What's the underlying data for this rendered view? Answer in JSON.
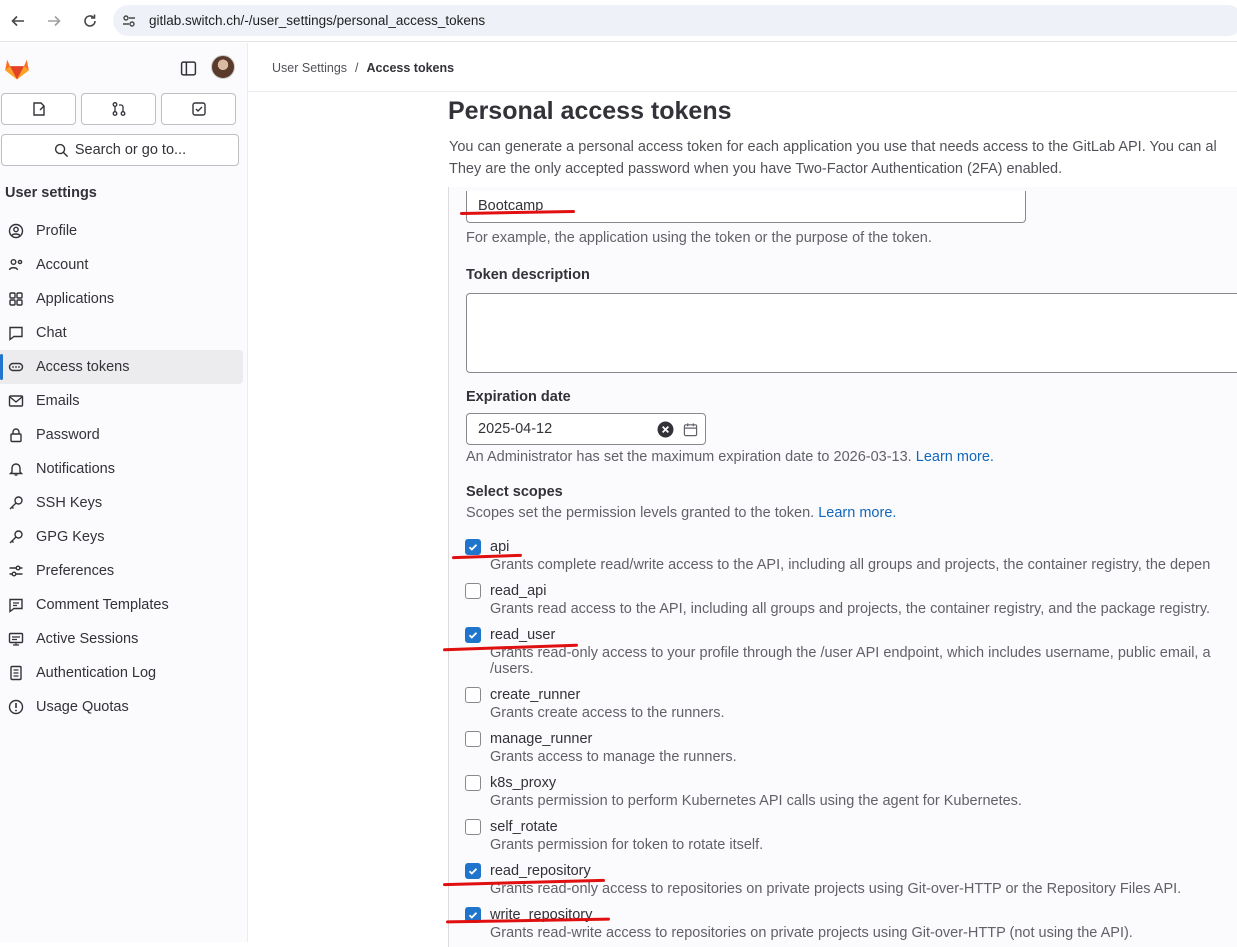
{
  "browser": {
    "url": "gitlab.switch.ch/-/user_settings/personal_access_tokens"
  },
  "sidebar": {
    "search_label": "Search or go to...",
    "section_title": "User settings",
    "items": [
      {
        "label": "Profile",
        "icon": "profile-icon"
      },
      {
        "label": "Account",
        "icon": "account-icon"
      },
      {
        "label": "Applications",
        "icon": "applications-icon"
      },
      {
        "label": "Chat",
        "icon": "chat-icon"
      },
      {
        "label": "Access tokens",
        "icon": "token-icon",
        "active": true
      },
      {
        "label": "Emails",
        "icon": "mail-icon"
      },
      {
        "label": "Password",
        "icon": "lock-icon"
      },
      {
        "label": "Notifications",
        "icon": "bell-icon"
      },
      {
        "label": "SSH Keys",
        "icon": "key-icon"
      },
      {
        "label": "GPG Keys",
        "icon": "key-icon"
      },
      {
        "label": "Preferences",
        "icon": "preferences-icon"
      },
      {
        "label": "Comment Templates",
        "icon": "comment-icon"
      },
      {
        "label": "Active Sessions",
        "icon": "monitor-icon"
      },
      {
        "label": "Authentication Log",
        "icon": "log-icon"
      },
      {
        "label": "Usage Quotas",
        "icon": "quota-icon"
      }
    ]
  },
  "breadcrumb": {
    "parent": "User Settings",
    "separator": "/",
    "current": "Access tokens"
  },
  "page": {
    "title": "Personal access tokens",
    "intro_line1": "You can generate a personal access token for each application you use that needs access to the GitLab API. You can al",
    "intro_line2": "They are the only accepted password when you have Two-Factor Authentication (2FA) enabled."
  },
  "form": {
    "token_name_value": "Bootcamp",
    "token_name_help": "For example, the application using the token or the purpose of the token.",
    "description_label": "Token description",
    "description_value": "",
    "expiration_label": "Expiration date",
    "expiration_value": "2025-04-12",
    "expiration_help": "An Administrator has set the maximum expiration date to 2026-03-13.",
    "learn_more": "Learn more.",
    "scopes_label": "Select scopes",
    "scopes_help": "Scopes set the permission levels granted to the token.",
    "scopes": [
      {
        "name": "api",
        "checked": true,
        "desc": "Grants complete read/write access to the API, including all groups and projects, the container registry, the depen"
      },
      {
        "name": "read_api",
        "checked": false,
        "desc": "Grants read access to the API, including all groups and projects, the container registry, and the package registry."
      },
      {
        "name": "read_user",
        "checked": true,
        "desc": "Grants read-only access to your profile through the /user API endpoint, which includes username, public email, a",
        "desc2": "/users."
      },
      {
        "name": "create_runner",
        "checked": false,
        "desc": "Grants create access to the runners."
      },
      {
        "name": "manage_runner",
        "checked": false,
        "desc": "Grants access to manage the runners."
      },
      {
        "name": "k8s_proxy",
        "checked": false,
        "desc": "Grants permission to perform Kubernetes API calls using the agent for Kubernetes."
      },
      {
        "name": "self_rotate",
        "checked": false,
        "desc": "Grants permission for token to rotate itself."
      },
      {
        "name": "read_repository",
        "checked": true,
        "desc": "Grants read-only access to repositories on private projects using Git-over-HTTP or the Repository Files API."
      },
      {
        "name": "write_repository",
        "checked": true,
        "desc": "Grants read-write access to repositories on private projects using Git-over-HTTP (not using the API)."
      }
    ]
  },
  "colors": {
    "accent": "#1f75cb",
    "annotation": "#e01010"
  }
}
